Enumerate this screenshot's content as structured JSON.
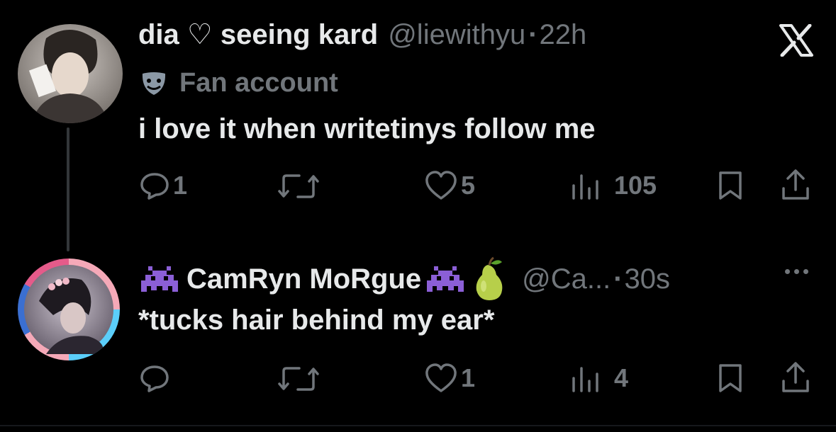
{
  "tweet1": {
    "display_name": "dia ♡ seeing kard",
    "handle": "@liewithyu",
    "dot": "·",
    "time": "22h",
    "badge_label": "Fan account",
    "text": "i love it when writetinys follow me",
    "replies": "1",
    "likes": "5",
    "views": "105",
    "icons": [
      "reply-icon",
      "retweet-icon",
      "like-icon",
      "views-icon",
      "bookmark-icon",
      "share-icon",
      "x-logo-icon",
      "masks-icon"
    ]
  },
  "tweet2": {
    "display_name": "CamRyn MoRgue",
    "handle": "@Ca...",
    "dot": "·",
    "time": "30s",
    "text": "*tucks hair behind my ear*",
    "likes": "1",
    "views": "4",
    "icons": [
      "alien-monster-emoji",
      "pear-emoji",
      "more-icon"
    ]
  },
  "colors": {
    "background": "#000000",
    "text_primary": "#e7e9ea",
    "text_muted": "#71767b",
    "thread_line": "#333639",
    "avatar_ring_pink": "#f5a9b8",
    "avatar_ring_blue": "#5bcefa"
  }
}
